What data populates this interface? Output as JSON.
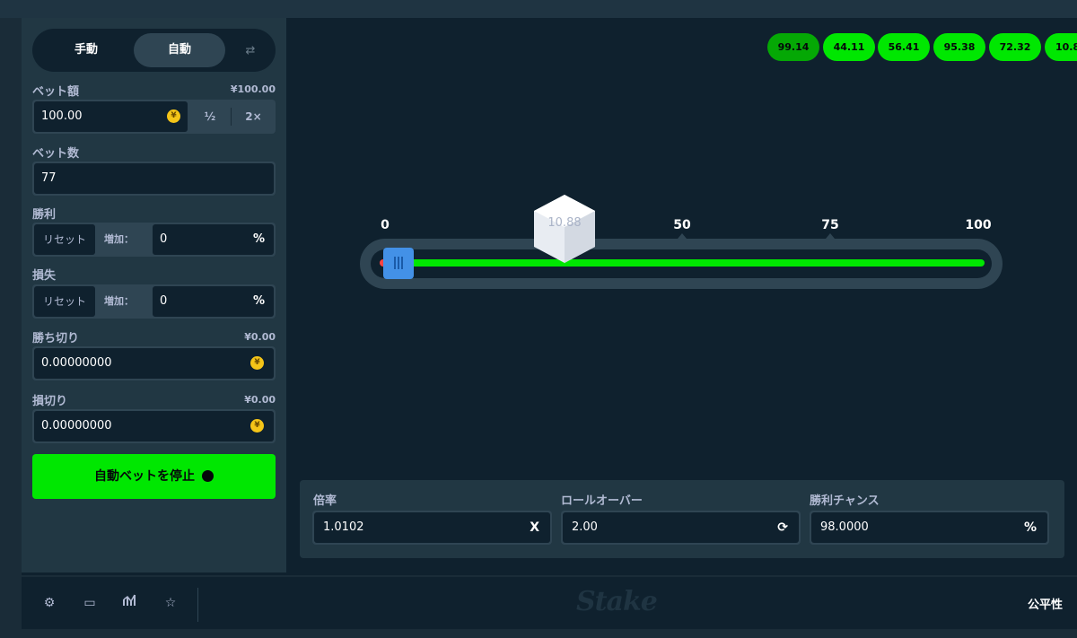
{
  "mode_tabs": {
    "manual": "手動",
    "auto": "自動"
  },
  "bet_amount": {
    "label": "ベット額",
    "total": "¥100.00",
    "value": "100.00",
    "half": "½",
    "double": "2×"
  },
  "bet_count": {
    "label": "ベット数",
    "value": "77"
  },
  "on_win": {
    "label": "勝利",
    "reset": "リセット",
    "increase": "増加：",
    "value": "0",
    "suffix": "%"
  },
  "on_loss": {
    "label": "損失",
    "reset": "リセット",
    "increase": "増加：",
    "value": "0",
    "suffix": "%"
  },
  "stop_profit": {
    "label": "勝ち切り",
    "total": "¥0.00",
    "value": "0.00000000"
  },
  "stop_loss": {
    "label": "損切り",
    "total": "¥0.00",
    "value": "0.00000000"
  },
  "stop_button": {
    "label": "自動ベットを停止"
  },
  "results": [
    "99.14",
    "44.11",
    "56.41",
    "95.38",
    "72.32",
    "10.8"
  ],
  "slider": {
    "ticks": [
      "0",
      "50",
      "75",
      "100"
    ],
    "roll_result": "10.88",
    "handle_value": 2
  },
  "panel": {
    "multiplier": {
      "label": "倍率",
      "value": "1.0102",
      "suffix": "X"
    },
    "roll_over": {
      "label": "ロールオーバー",
      "value": "2.00"
    },
    "win_chance": {
      "label": "勝利チャンス",
      "value": "98.0000",
      "suffix": "%"
    }
  },
  "footer": {
    "logo": "Stake",
    "fairness": "公平性"
  },
  "colors": {
    "accent_green": "#00e701",
    "panel": "#213743",
    "dark": "#0f212e",
    "handle_blue": "#4391e7"
  }
}
